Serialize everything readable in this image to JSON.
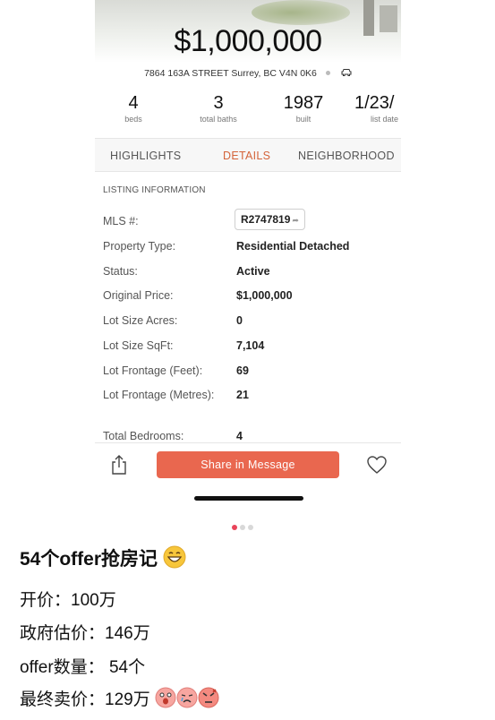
{
  "listing": {
    "price": "$1,000,000",
    "address": "7864 163A STREET Surrey, BC V4N 0K6",
    "stats": [
      {
        "value": "4",
        "label": "beds"
      },
      {
        "value": "3",
        "label": "total baths"
      },
      {
        "value": "1987",
        "label": "built"
      },
      {
        "value": "1/23/",
        "label": "list date"
      }
    ],
    "tabs": [
      "HIGHLIGHTS",
      "DETAILS",
      "NEIGHBORHOOD"
    ],
    "active_tab": "DETAILS",
    "section_title": "LISTING INFORMATION",
    "mls_label": "MLS #:",
    "mls_value": "R2747819",
    "fields": [
      {
        "label": "Property Type:",
        "value": "Residential Detached"
      },
      {
        "label": "Status:",
        "value": "Active"
      },
      {
        "label": "Original Price:",
        "value": "$1,000,000"
      },
      {
        "label": "Lot Size Acres:",
        "value": "0"
      },
      {
        "label": "Lot Size SqFt:",
        "value": "7,104"
      },
      {
        "label": "Lot Frontage (Feet):",
        "value": "69"
      },
      {
        "label": "Lot Frontage (Metres):",
        "value": "21"
      },
      {
        "label": "Total Bedrooms:",
        "value": "4"
      }
    ],
    "share_label": "Share in Message"
  },
  "pager": {
    "count": 3,
    "active": 0
  },
  "post": {
    "title": "54个offer抢房记",
    "lines": [
      "开价：100万",
      "政府估价：146万",
      "offer数量：  54个",
      "最终卖价：129万"
    ]
  },
  "colors": {
    "accent": "#d4643a",
    "button": "#e9674f",
    "pager_active": "#e9445a"
  }
}
